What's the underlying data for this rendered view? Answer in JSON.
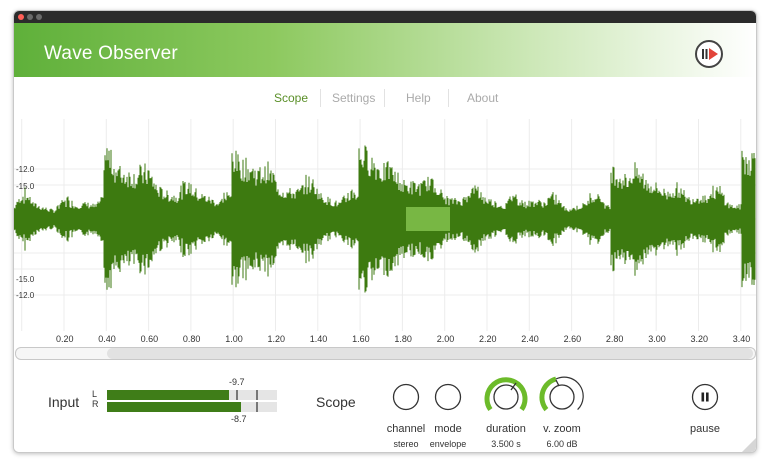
{
  "app": {
    "title": "Wave Observer"
  },
  "nav": {
    "items": [
      "Scope",
      "Settings",
      "Help",
      "About"
    ],
    "active": "Scope"
  },
  "scope": {
    "y_labels_top": [
      "-12.0",
      "-15.0"
    ],
    "y_labels_bottom": [
      "-15.0",
      "-12.0"
    ],
    "x_ticks": [
      "0.20",
      "0.40",
      "0.60",
      "0.80",
      "1.00",
      "1.20",
      "1.40",
      "1.60",
      "1.80",
      "2.00",
      "2.20",
      "2.40",
      "2.60",
      "2.80",
      "3.00",
      "3.20",
      "3.40"
    ],
    "colors": {
      "waveform": "#3d7a10",
      "highlight": "#8ccc55",
      "grid": "#ececec"
    }
  },
  "controls": {
    "input_label": "Input",
    "left_label": "L",
    "right_label": "R",
    "left_level_db": "-9.7",
    "right_level_db": "-8.7",
    "left_fill": 0.72,
    "right_fill": 0.79,
    "scope_label": "Scope",
    "channel": {
      "label": "channel",
      "value": "stereo"
    },
    "mode": {
      "label": "mode",
      "value": "envelope"
    },
    "duration": {
      "label": "duration",
      "value": "3.500 s"
    },
    "vzoom": {
      "label": "v. zoom",
      "value": "6.00 dB"
    },
    "pause": {
      "label": "pause"
    }
  }
}
